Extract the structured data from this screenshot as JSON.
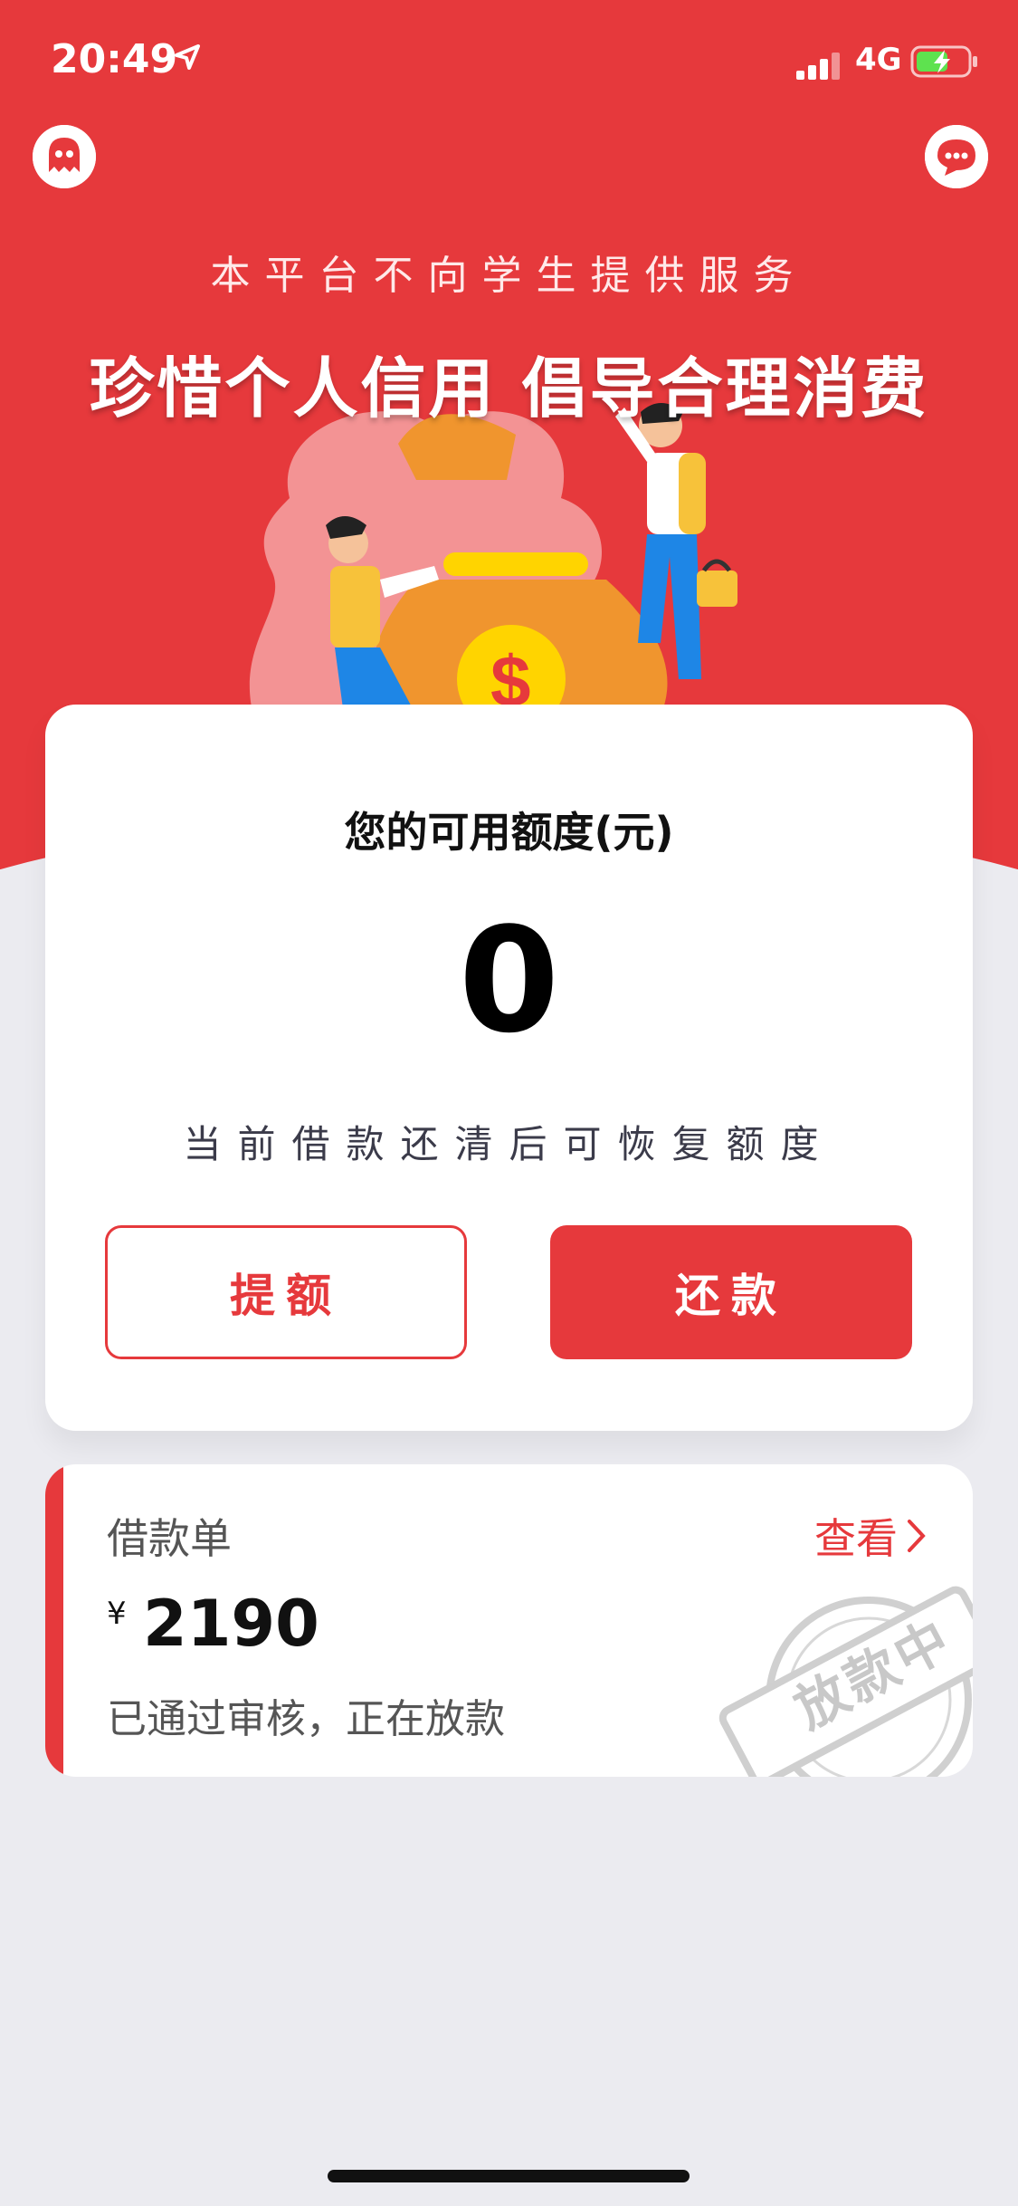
{
  "status_bar": {
    "time": "20:49",
    "network": "4G"
  },
  "header": {
    "subtitle": "本平台不向学生提供服务",
    "headline": "珍惜个人信用 倡导合理消费"
  },
  "credit_card": {
    "title": "您的可用额度(元)",
    "amount": "0",
    "note": "当前借款还清后可恢复额度",
    "raise_button": "提额",
    "repay_button": "还款"
  },
  "loan": {
    "label": "借款单",
    "view_link": "查看",
    "currency": "¥",
    "amount": "2190",
    "status": "已通过审核，正在放款",
    "stamp_text": "放款中"
  },
  "colors": {
    "accent": "#e6393c",
    "background": "#ebebf0"
  },
  "icons": [
    "location-arrow-icon",
    "signal-icon",
    "battery-charging-icon",
    "avatar-icon",
    "chat-icon",
    "chevron-right-icon"
  ]
}
